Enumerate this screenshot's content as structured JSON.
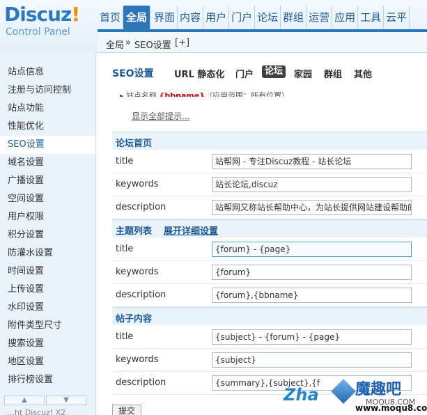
{
  "logo": {
    "brand": "Discuz",
    "mark": "!",
    "subtitle": "Control Panel"
  },
  "topnav": [
    "首页",
    "全局",
    "界面",
    "内容",
    "用户",
    "门户",
    "论坛",
    "群组",
    "运营",
    "应用",
    "工具",
    "云平"
  ],
  "topnav_active": "全局",
  "breadcrumb": {
    "parent": "全局",
    "sep": "»",
    "current": "SEO设置",
    "add": "[+]"
  },
  "sidebar": {
    "items": [
      "站点信息",
      "注册与访问控制",
      "站点功能",
      "性能优化",
      "SEO设置",
      "域名设置",
      "广播设置",
      "空间设置",
      "用户权限",
      "积分设置",
      "防灌水设置",
      "时间设置",
      "上传设置",
      "水印设置",
      "附件类型尺寸",
      "搜索设置",
      "地区设置",
      "排行榜设置"
    ],
    "active": "SEO设置",
    "up_icon": "▲",
    "down_icon": "▼",
    "extra": "…ht Discuz! X2"
  },
  "subnav": {
    "title": "SEO设置",
    "tabs": [
      "URL 静态化",
      "门户",
      "论坛",
      "家园",
      "群组",
      "其他"
    ],
    "active": "论坛"
  },
  "hint": {
    "prefix": "站点名称",
    "var": "{bbname}",
    "suffix": "（应用范围：所有位置）"
  },
  "show_all": "显示全部提示...",
  "sections": [
    {
      "title": "论坛首页",
      "rows": [
        {
          "label": "title",
          "value": "站帮网 - 专注Discuz教程 - 站长论坛"
        },
        {
          "label": "keywords",
          "value": "站长论坛,discuz"
        },
        {
          "label": "description",
          "value": "站帮网又称站长帮助中心，为站长提供网站建设帮助的"
        }
      ]
    },
    {
      "title": "主题列表",
      "link": "展开详细设置",
      "rows": [
        {
          "label": "title",
          "value": "{forum} - {page}"
        },
        {
          "label": "keywords",
          "value": "{forum}"
        },
        {
          "label": "description",
          "value": "{forum},{bbname}"
        }
      ]
    },
    {
      "title": "帖子内容",
      "rows": [
        {
          "label": "title",
          "value": "{subject} - {forum} - {page}"
        },
        {
          "label": "keywords",
          "value": "{subject}"
        },
        {
          "label": "description",
          "value": "{summary},{subject},{f"
        }
      ]
    }
  ],
  "submit": "提交",
  "watermark": {
    "zhan": "Zha",
    "cn": "魔趣吧",
    "moqu": "MOQU8.COM",
    "url": "www.moqu8.com"
  },
  "colors": {
    "accent": "#2d76b8",
    "sidebar_bg": "#eaf2fa",
    "link": "#1c5a98"
  }
}
